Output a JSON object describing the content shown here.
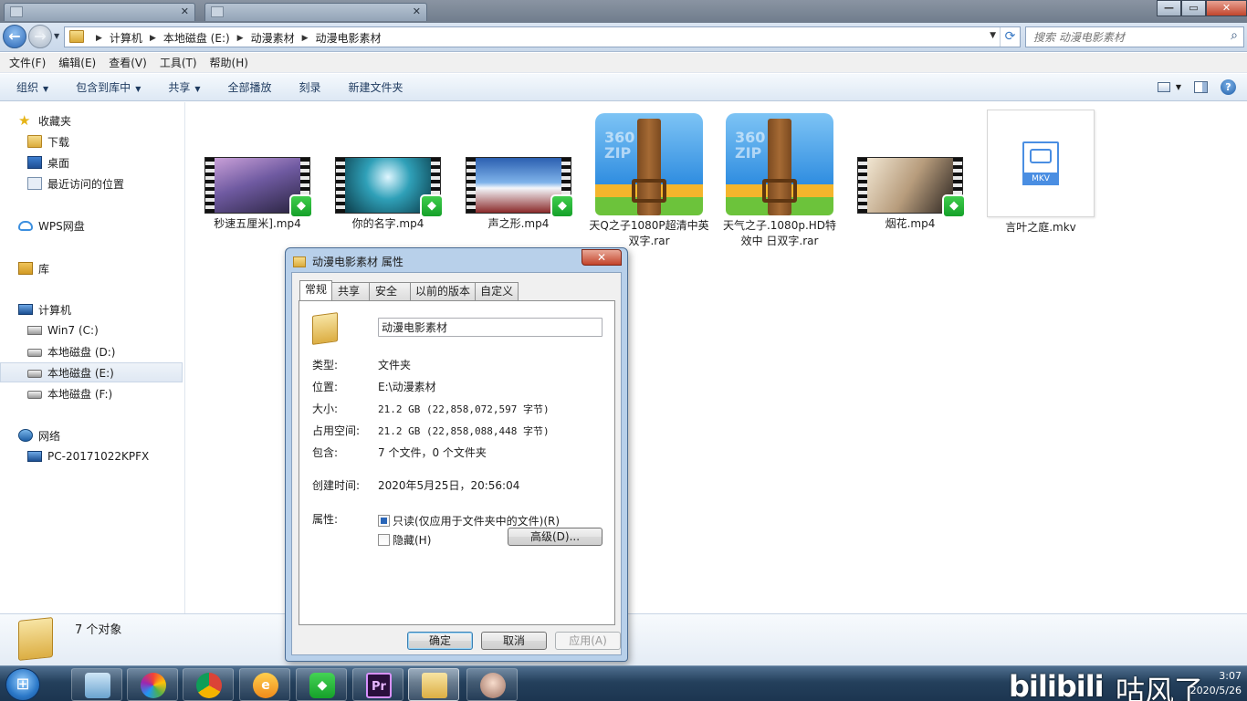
{
  "address": {
    "breadcrumbs": [
      "计算机",
      "本地磁盘 (E:)",
      "动漫素材",
      "动漫电影素材"
    ],
    "search_placeholder": "搜索 动漫电影素材"
  },
  "menu": [
    "文件(F)",
    "编辑(E)",
    "查看(V)",
    "工具(T)",
    "帮助(H)"
  ],
  "commands": [
    {
      "label": "组织",
      "dropdown": true
    },
    {
      "label": "包含到库中",
      "dropdown": true
    },
    {
      "label": "共享",
      "dropdown": true
    },
    {
      "label": "全部播放",
      "dropdown": false
    },
    {
      "label": "刻录",
      "dropdown": false
    },
    {
      "label": "新建文件夹",
      "dropdown": false
    }
  ],
  "nav": {
    "favorites": "收藏夹",
    "downloads": "下载",
    "desktop": "桌面",
    "recent": "最近访问的位置",
    "wps": "WPS网盘",
    "library": "库",
    "computer": "计算机",
    "drive_c": "Win7 (C:)",
    "drive_d": "本地磁盘 (D:)",
    "drive_e": "本地磁盘 (E:)",
    "drive_f": "本地磁盘 (F:)",
    "network": "网络",
    "host": "PC-20171022KPFX"
  },
  "files": [
    {
      "name": "秒速五厘米].mp4",
      "kind": "video"
    },
    {
      "name": "你的名字.mp4",
      "kind": "video"
    },
    {
      "name": "声之形.mp4",
      "kind": "video"
    },
    {
      "name": "天Q之子1080P超清中英双字.rar",
      "kind": "archive"
    },
    {
      "name": "天气之子.1080p.HD特效中 日双字.rar",
      "kind": "archive"
    },
    {
      "name": "烟花.mp4",
      "kind": "video"
    },
    {
      "name": "言叶之庭.mkv",
      "kind": "mkv"
    }
  ],
  "file_icons": {
    "archive_text": "360\nZIP",
    "mkv_tag": "MKV"
  },
  "details": {
    "count": "7 个对象"
  },
  "dialog": {
    "title": "动漫电影素材 属性",
    "tabs": [
      "常规",
      "共享",
      "安全",
      "以前的版本",
      "自定义"
    ],
    "active_tab": 0,
    "name": "动漫电影素材",
    "type_label": "类型:",
    "type_value": "文件夹",
    "location_label": "位置:",
    "location_value": "E:\\动漫素材",
    "size_label": "大小:",
    "size_value": "21.2 GB (22,858,072,597 字节)",
    "disk_label": "占用空间:",
    "disk_value": "21.2 GB (22,858,088,448 字节)",
    "contains_label": "包含:",
    "contains_value": "7 个文件，0 个文件夹",
    "created_label": "创建时间:",
    "created_value": "2020年5月25日，20:56:04",
    "attr_label": "属性:",
    "readonly_label": "只读(仅应用于文件夹中的文件)(R)",
    "readonly_checked": true,
    "hidden_label": "隐藏(H)",
    "hidden_checked": false,
    "advanced_label": "高级(D)...",
    "ok_label": "确定",
    "cancel_label": "取消",
    "apply_label": "应用(A)"
  },
  "taskbar": {
    "watermark": "bilibili",
    "watermark_suffix": "咕风了",
    "time": "3:07",
    "date": "2020/5/26"
  },
  "colors": {
    "accent": "#2b66b4",
    "badge": "#16a12a",
    "window_frame": "#b8d0ea"
  }
}
